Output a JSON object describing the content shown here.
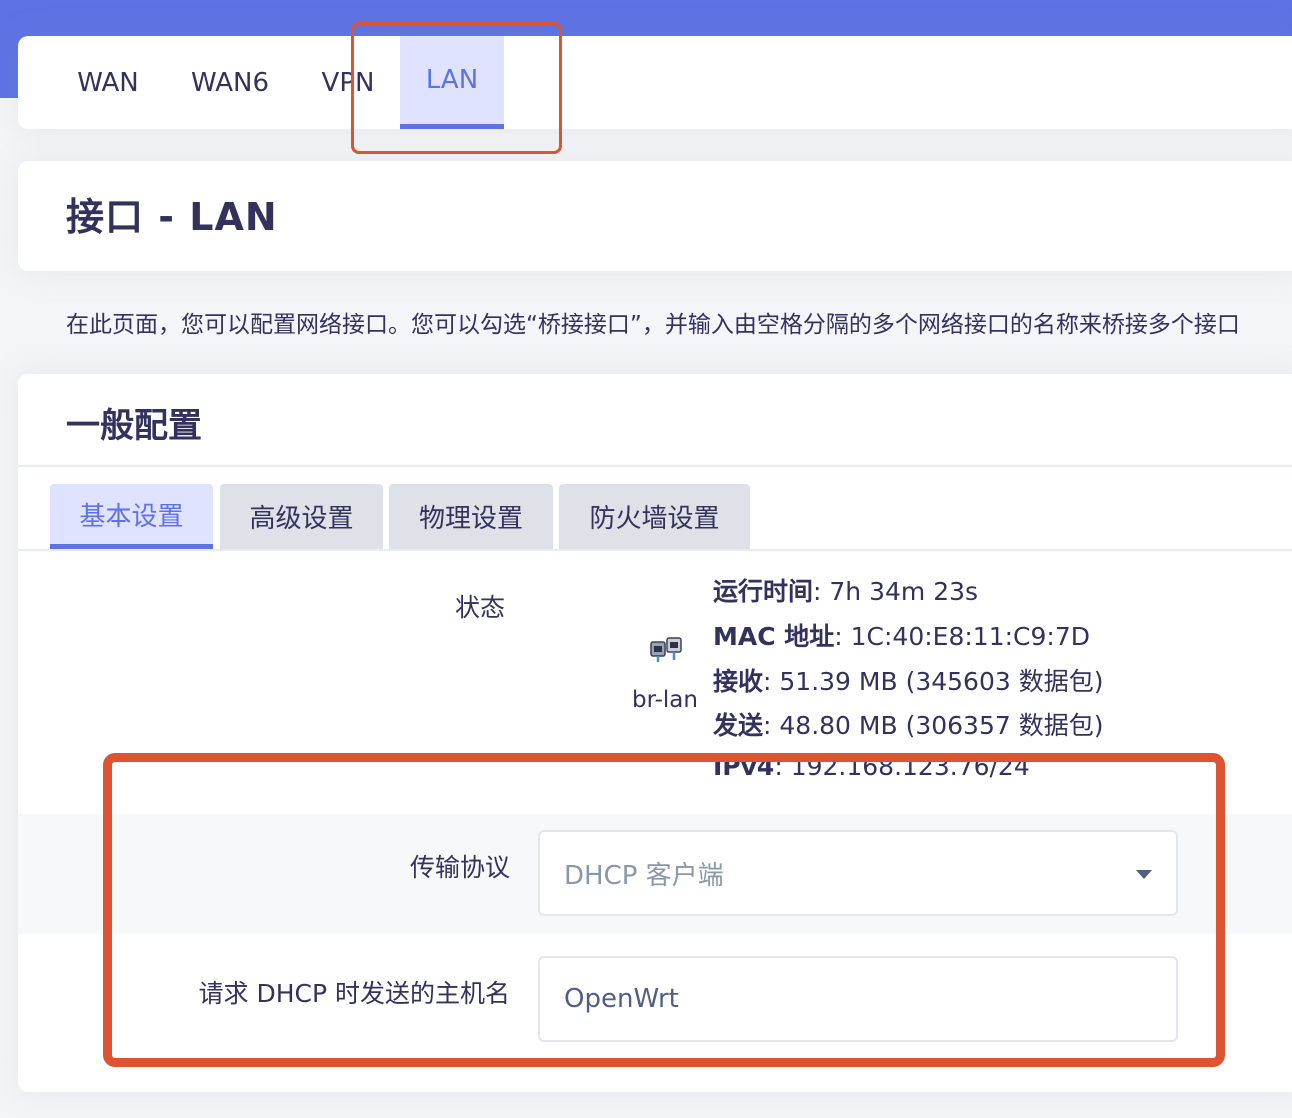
{
  "nav": {
    "tabs": [
      {
        "label": "WAN"
      },
      {
        "label": "WAN6"
      },
      {
        "label": "VPN"
      },
      {
        "label": "LAN"
      }
    ],
    "active": "LAN"
  },
  "page": {
    "title": "接口 - LAN",
    "description": "在此页面，您可以配置网络接口。您可以勾选“桥接接口”，并输入由空格分隔的多个网络接口的名称来桥接多个接口"
  },
  "section": {
    "title": "一般配置",
    "subtabs": [
      {
        "label": "基本设置"
      },
      {
        "label": "高级设置"
      },
      {
        "label": "物理设置"
      },
      {
        "label": "防火墙设置"
      }
    ],
    "active_subtab": "基本设置"
  },
  "status": {
    "label": "状态",
    "iface_icon": "ethernet-interface-icon",
    "iface_name": "br-lan",
    "uptime_key": "运行时间",
    "uptime_val": ": 7h 34m 23s",
    "mac_key": "MAC 地址",
    "mac_val": ": 1C:40:E8:11:C9:7D",
    "rx_key": "接收",
    "rx_val": ": 51.39 MB (345603 数据包)",
    "tx_key": "发送",
    "tx_val": ": 48.80 MB (306357 数据包)",
    "ipv4_key": "IPv4",
    "ipv4_val": ": 192.168.123.76/24"
  },
  "form": {
    "protocol_label": "传输协议",
    "protocol_value": "DHCP 客户端",
    "hostname_label": "请求 DHCP 时发送的主机名",
    "hostname_value": "OpenWrt"
  },
  "colors": {
    "accent": "#5e72e4",
    "highlight_box": "#dd5432"
  }
}
